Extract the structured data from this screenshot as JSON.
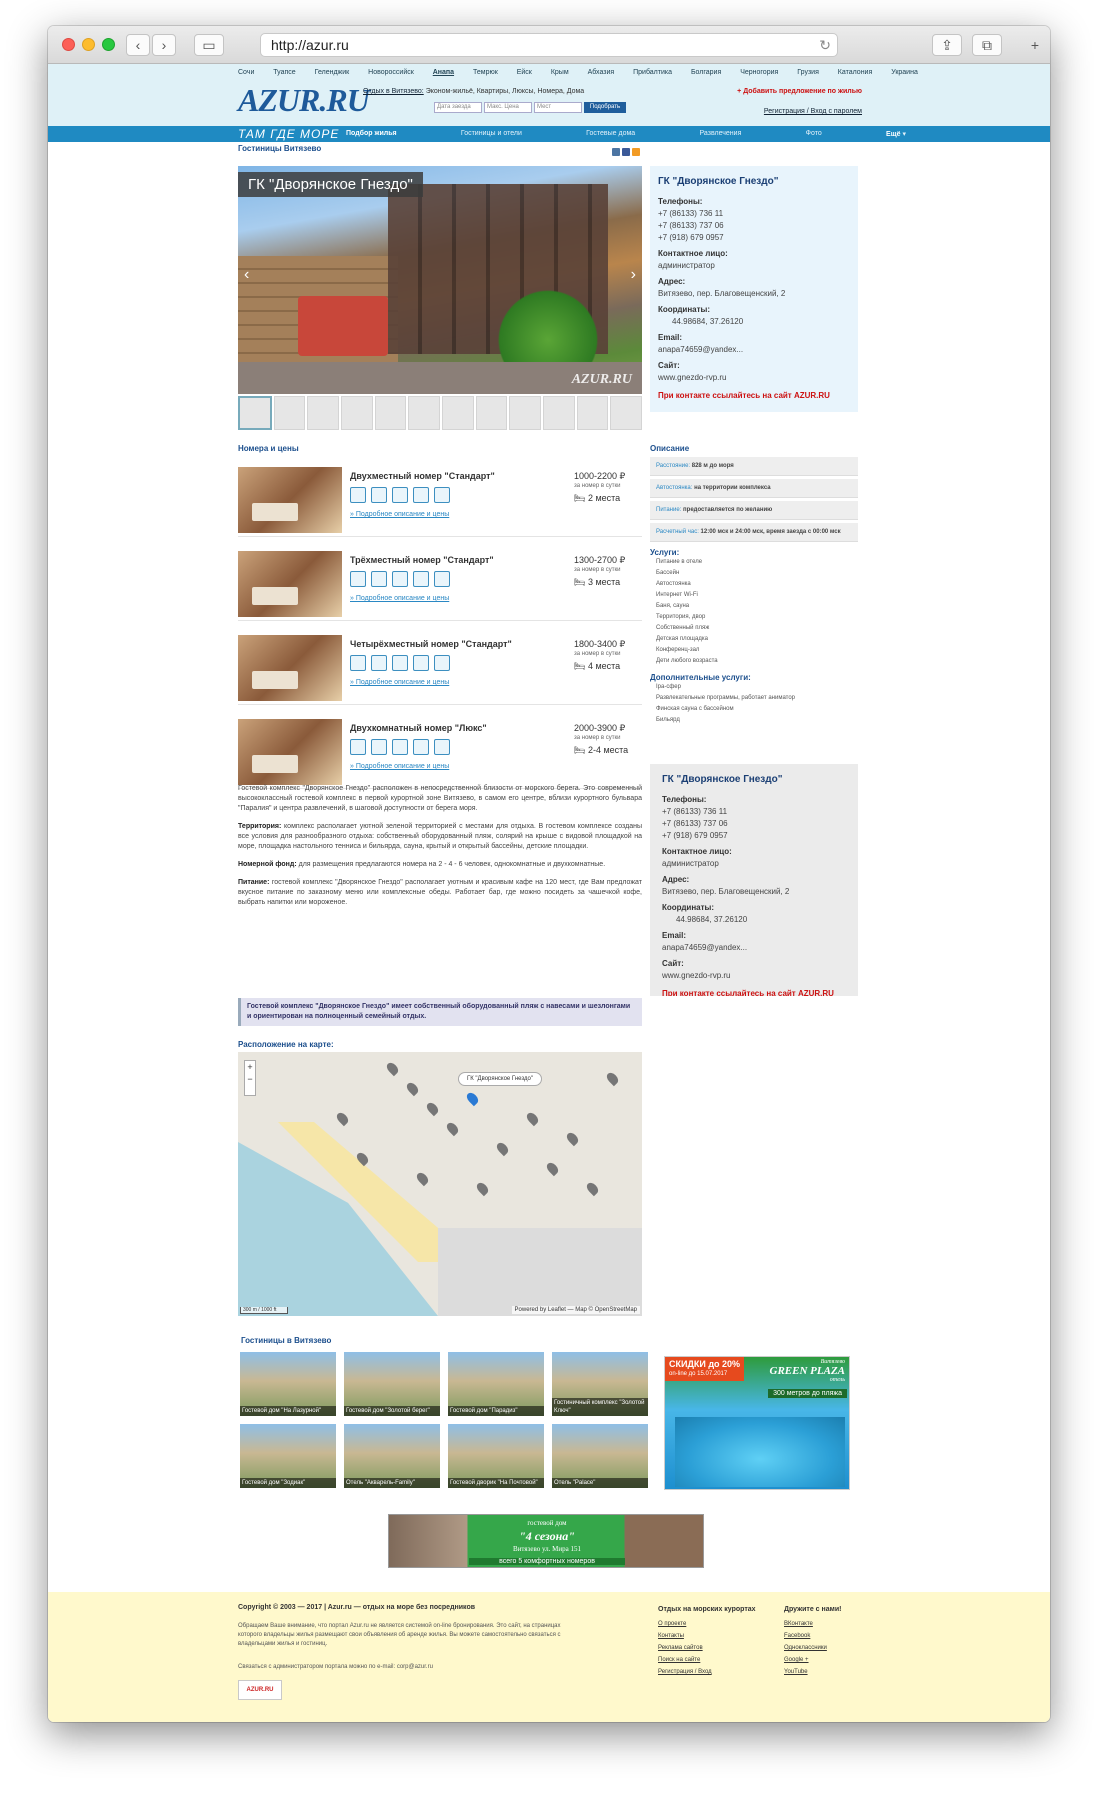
{
  "browser": {
    "url": "http://azur.ru"
  },
  "header": {
    "cities": [
      "Сочи",
      "Туапсе",
      "Геленджик",
      "Новороссийск",
      "Анапа",
      "Темрюк",
      "Ейск",
      "Крым",
      "Абхазия",
      "Прибалтика",
      "Болгария",
      "Черногория",
      "Грузия",
      "Каталония",
      "Украина"
    ],
    "logo": "AZUR.RU",
    "rest_label": "Отдых в Витязево:",
    "rest_types": "Эконом-жильё, Квартиры, Люксы, Номера, Дома",
    "search_fields": [
      "Дата заезда",
      "Макс. Цена",
      "Мест"
    ],
    "search_button": "Подобрать",
    "add_offer": "+ Добавить предложение по жилью",
    "register": "Регистрация / Вход с паролем"
  },
  "nav": {
    "brand": "ТАМ ГДЕ МОРЕ",
    "items": [
      "Подбор жилья",
      "Гостиницы и отели",
      "Гостевые дома",
      "Развлечения",
      "Фото",
      "Ещё"
    ]
  },
  "page": {
    "breadcrumb": "Гостиницы Витязево",
    "hero_caption": "ГК \"Дворянское Гнездо\"",
    "watermark": "AZUR.RU"
  },
  "contact": {
    "name": "ГК \"Дворянское Гнездо\"",
    "phones_label": "Телефоны:",
    "phones": [
      "+7 (86133) 736 11",
      "+7 (86133) 737 06",
      "+7 (918) 679 0957"
    ],
    "contact_label": "Контактное лицо:",
    "contact_person": "администратор",
    "address_label": "Адрес:",
    "address": "Витязево, пер. Благовещенский, 2",
    "coords_label": "Координаты:",
    "coords": "44.98684, 37.26120",
    "email_label": "Email:",
    "email": "anapa74659@yandex...",
    "site_label": "Сайт:",
    "site": "www.gnezdo-rvp.ru",
    "note": "При контакте ссылайтесь на сайт AZUR.RU"
  },
  "rooms_title": "Номера и цены",
  "rooms": [
    {
      "name": "Двухместный номер \"Стандарт\"",
      "price": "1000-2200 ₽",
      "per": "за номер в сутки",
      "capacity": "2 места",
      "more": "» Подробное описание и цены"
    },
    {
      "name": "Трёхместный номер \"Стандарт\"",
      "price": "1300-2700 ₽",
      "per": "за номер в сутки",
      "capacity": "3 места",
      "more": "» Подробное описание и цены"
    },
    {
      "name": "Четырёхместный номер \"Стандарт\"",
      "price": "1800-3400 ₽",
      "per": "за номер в сутки",
      "capacity": "4 места",
      "more": "» Подробное описание и цены"
    },
    {
      "name": "Двухкомнатный номер \"Люкс\"",
      "price": "2000-3900 ₽",
      "per": "за номер в сутки",
      "capacity": "2-4 места",
      "more": "» Подробное описание и цены"
    }
  ],
  "description": {
    "p1": "Гостевой комплекс \"Дворянское Гнездо\" расположен в непосредственной близости от морского берега. Это современный высококлассный гостевой комплекс в первой курортной зоне Витязево, в самом его центре, вблизи курортного бульвара \"Паралия\" и центра развлечений, в шаговой доступности от берега моря.",
    "p2_label": "Территория:",
    "p2": "комплекс располагает уютной зеленой территорией с местами для отдыха. В гостевом комплексе созданы все условия для разнообразного отдыха: собственный оборудованный пляж, солярий на крыше с видовой площадкой на море, площадка настольного тенниса и бильярда, сауна, крытый и открытый бассейны, детские площадки.",
    "p3_label": "Номерной фонд:",
    "p3": "для размещения предлагаются номера на 2 - 4 - 6 человек, однокомнатные и двухкомнатные.",
    "p4_label": "Питание:",
    "p4": "гостевой комплекс \"Дворянское Гнездо\" располагает уютным и красивым кафе на 120 мест, где Вам предложат вкусное питание по заказному меню или комплексные обеды. Работает бар, где можно посидеть за чашечкой кофе, выбрать напитки или мороженое.",
    "highlight": "Гостевой комплекс \"Дворянское Гнездо\" имеет собственный оборудованный пляж с навесами и шезлонгами и ориентирован на полноценный семейный отдых."
  },
  "map": {
    "title": "Расположение на карте:",
    "popup": "ГК \"Дворянское Гнездо\"",
    "scale": "300 m / 1000 ft",
    "attribution": "Powered by Leaflet — Map © OpenStreetMap"
  },
  "side": {
    "desc_title": "Описание",
    "rows": [
      {
        "k": "Расстояние:",
        "v": "828 м до моря"
      },
      {
        "k": "Автостоянка:",
        "v": "на территории комплекса"
      },
      {
        "k": "Питание:",
        "v": "предоставляется по желанию"
      },
      {
        "k": "Расчетный час:",
        "v": "12:00 мск и 24:00 мск, время заезда с 00:00 мск"
      }
    ],
    "services_title": "Услуги:",
    "services": [
      "Питание в отеле",
      "Бассейн",
      "Автостоянка",
      "Интернет Wi-Fi",
      "Баня, сауна",
      "Территория, двор",
      "Собственный пляж",
      "Детская площадка",
      "Конференц-зал",
      "Дети любого возраста"
    ],
    "extra_title": "Дополнительные услуги:",
    "extra": [
      "Іра-сфер",
      "Развлекательные программы, работает аниматор",
      "Финская сауна с бассейном",
      "Бильярд"
    ]
  },
  "hotels": {
    "title": "Гостиницы в Витязево",
    "items": [
      "Гостевой дом \"На Лазурной\"",
      "Гостевой дом \"Золотой берег\"",
      "Гостевой дом \"Парадиз\"",
      "Гостиничный комплекс \"Золотой Ключ\"",
      "Гостевой дом \"Зодиак\"",
      "Отель \"Акварель-Family\"",
      "Гостевой дворик \"На Почтовой\"",
      "Отель \"Palace\""
    ]
  },
  "ads": {
    "discount": "СКИДКИ до 20%",
    "discount_sub": "on-line до 15.07.2017",
    "brand_top": "Витязево",
    "brand": "GREEN PLAZA",
    "brand_sub": "отель",
    "distance": "300 метров до пляжа",
    "banner_top": "гостевой дом",
    "banner_name": "\"4 сезона\"",
    "banner_addr": "Витязево ул. Мира 151",
    "banner_bottom": "всего 5 комфортных номеров"
  },
  "footer": {
    "copyright": "Copyright © 2003 — 2017 | Azur.ru — отдых на море без посредников",
    "about": "Обращаем Ваше внимание, что портал Azur.ru не является системой on-line бронирования. Это сайт, на страницах которого владельцы жилья размещают свои объявления об аренде жилья. Вы можете самостоятельно связаться с владельцами жилья и гостиниц.",
    "admin": "Связаться с администратором портала можно по e-mail: corp@azur.ru",
    "badge": "AZUR.RU",
    "col1_title": "Отдых на морских курортах",
    "col1": [
      "О проекте",
      "Контакты",
      "Реклама сайтов",
      "Поиск на сайте",
      "Регистрация / Вход"
    ],
    "col2_title": "Дружите с нами!",
    "col2": [
      "ВКонтакте",
      "Facebook",
      "Одноклассники",
      "Google +",
      "YouTube"
    ]
  },
  "colors": {
    "accent": "#1f8ac2",
    "header_bg": "#dff1f7",
    "footer_bg": "#fff9cc",
    "title": "#1c4f8d",
    "alert": "#cc1111"
  }
}
